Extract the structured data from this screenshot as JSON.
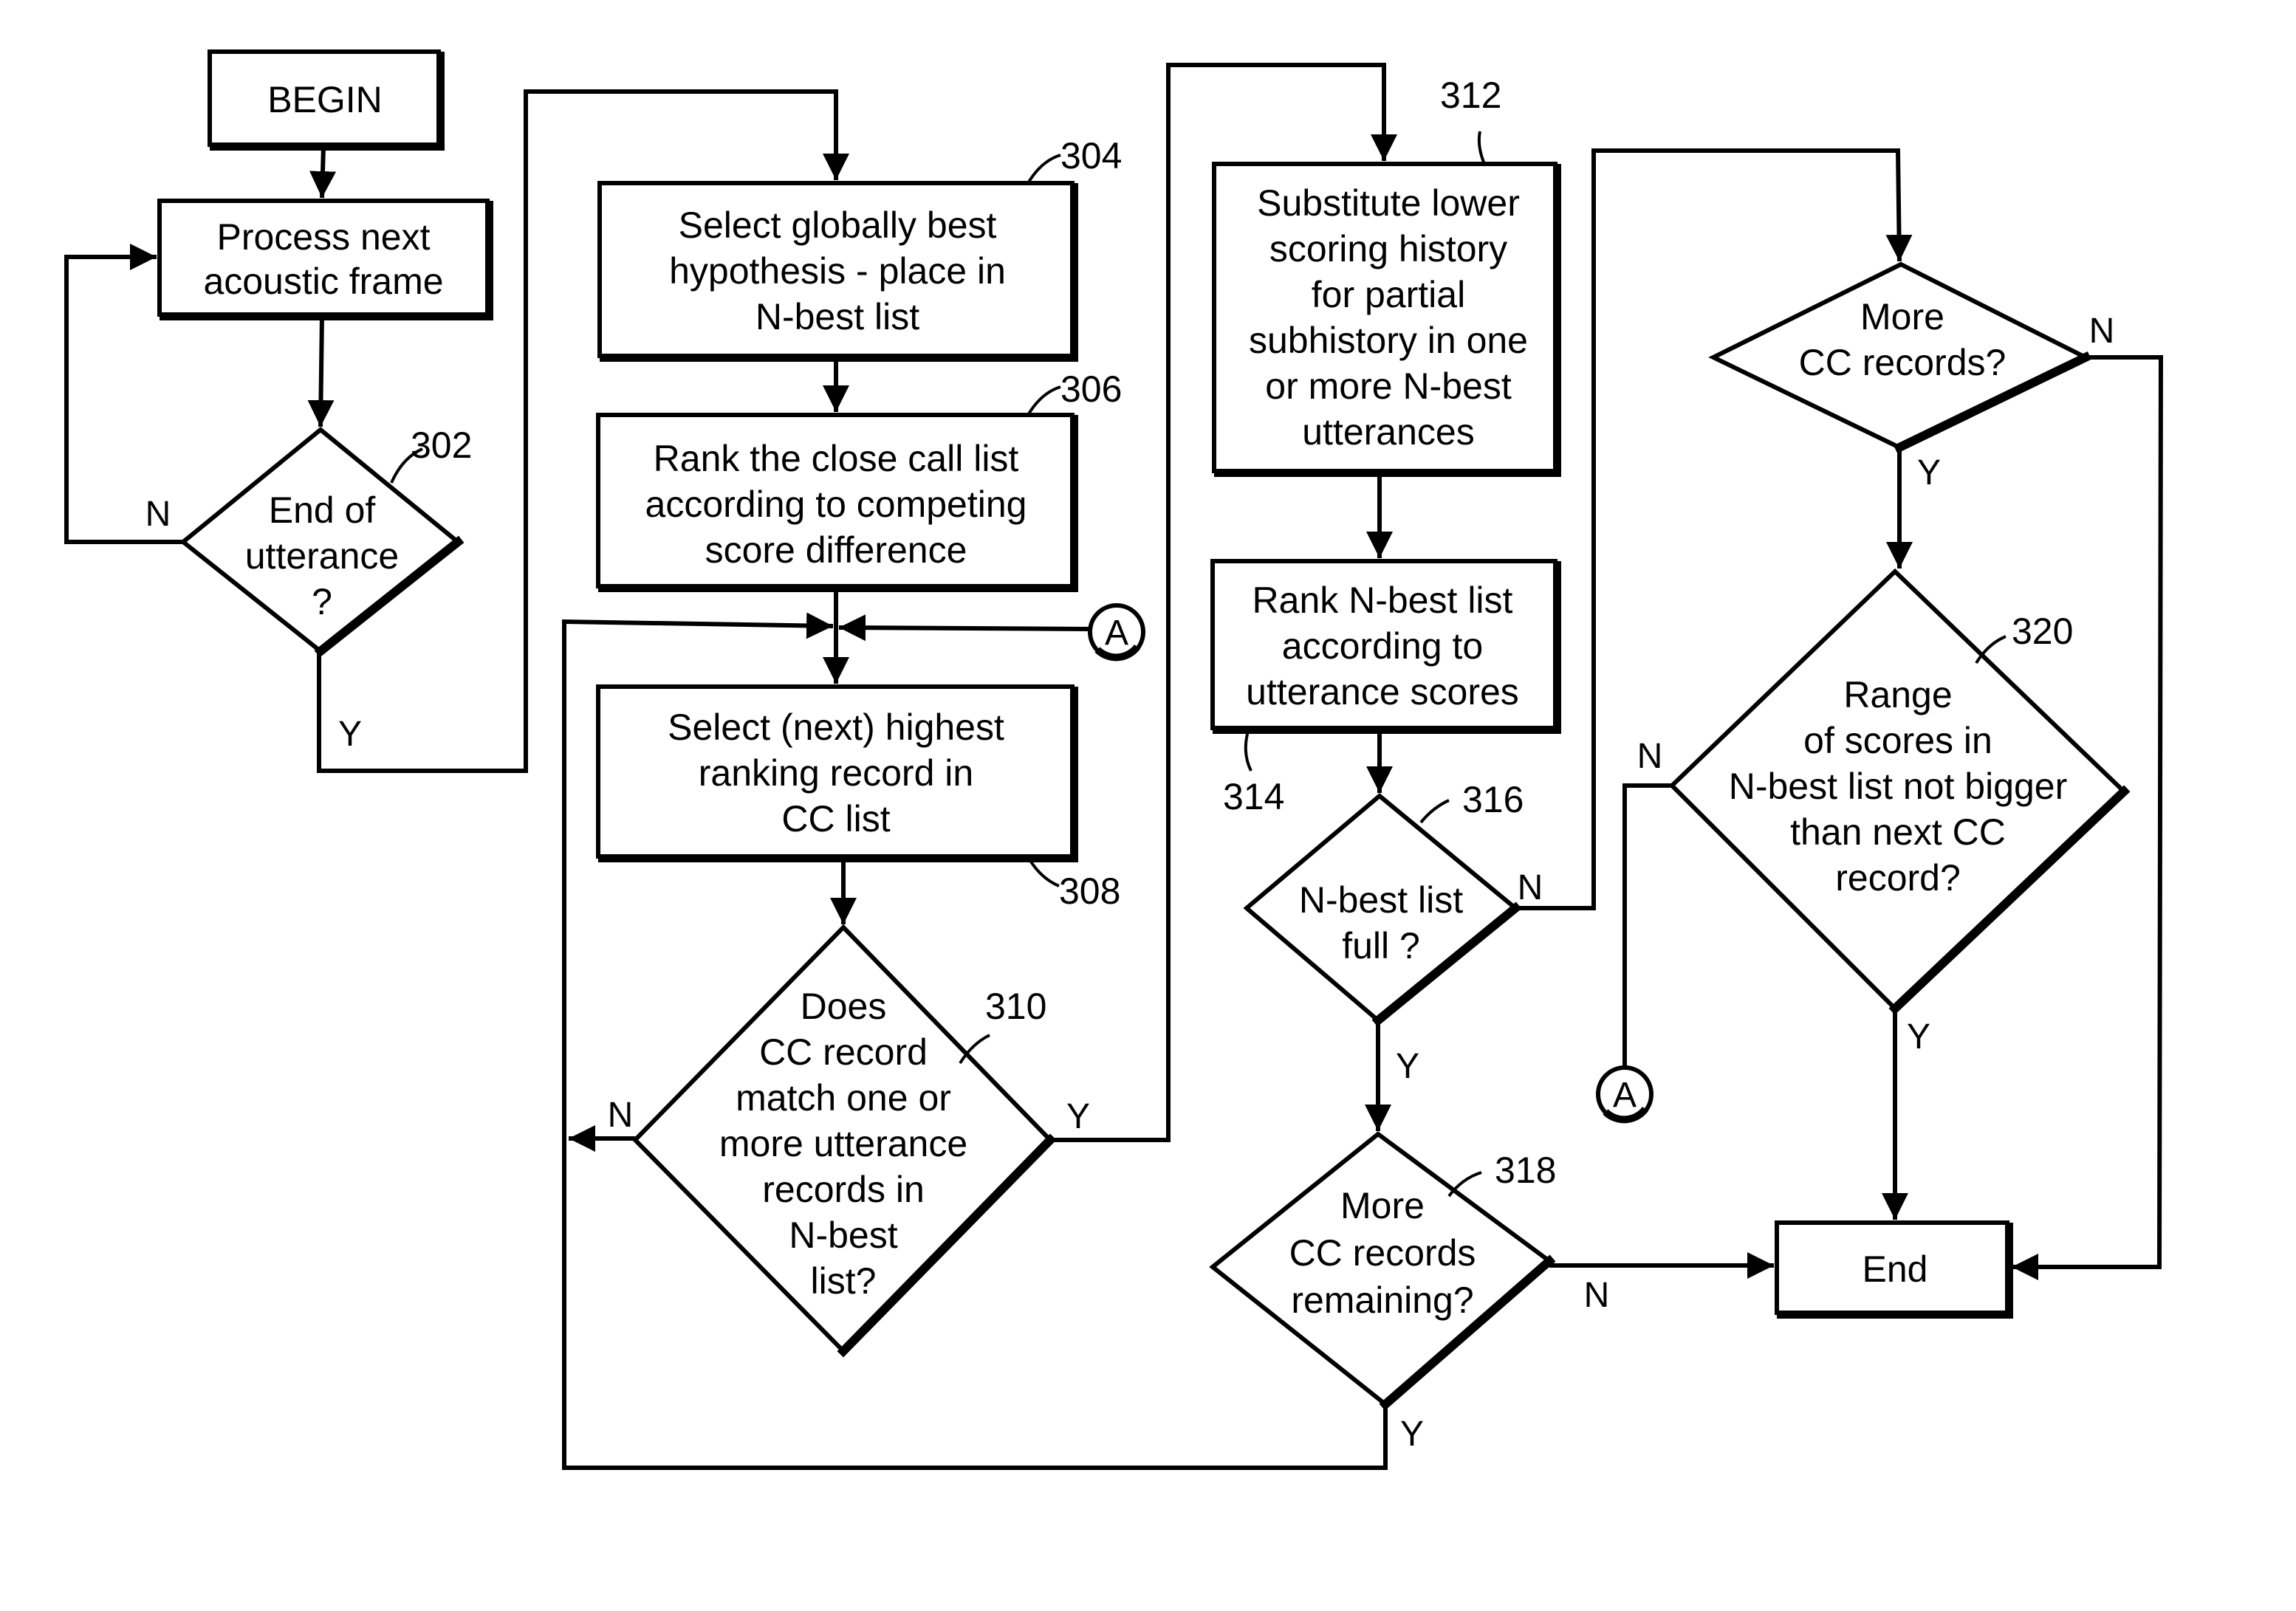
{
  "diagram": {
    "type": "flowchart",
    "nodes": {
      "begin": {
        "id": "begin",
        "kind": "terminal",
        "lines": [
          "BEGIN"
        ]
      },
      "process_frame": {
        "id": "process_frame",
        "kind": "process",
        "lines": [
          "Process next",
          "acoustic frame"
        ]
      },
      "n302": {
        "id": "302",
        "kind": "decision",
        "ref": "302",
        "lines": [
          "End of",
          "utterance",
          "?"
        ]
      },
      "n304": {
        "id": "304",
        "kind": "process",
        "ref": "304",
        "lines": [
          "Select globally best",
          "hypothesis - place in",
          "N-best list"
        ]
      },
      "n306": {
        "id": "306",
        "kind": "process",
        "ref": "306",
        "lines": [
          "Rank the close call list",
          "according to competing",
          "score difference"
        ]
      },
      "n308": {
        "id": "308",
        "kind": "process",
        "ref": "308",
        "lines": [
          "Select (next) highest",
          "ranking record in",
          "CC list"
        ]
      },
      "n310": {
        "id": "310",
        "kind": "decision",
        "ref": "310",
        "lines": [
          "Does",
          "CC record",
          "match one or",
          "more utterance",
          "records in",
          "N-best",
          "list?"
        ]
      },
      "n312": {
        "id": "312",
        "kind": "process",
        "ref": "312",
        "lines": [
          "Substitute lower",
          "scoring history",
          "for partial",
          "subhistory in one",
          "or more N-best",
          "utterances"
        ]
      },
      "n314": {
        "id": "314",
        "kind": "process",
        "ref": "314",
        "lines": [
          "Rank N-best list",
          "according to",
          "utterance scores"
        ]
      },
      "n316": {
        "id": "316",
        "kind": "decision",
        "ref": "316",
        "lines": [
          "N-best list",
          "full ?"
        ]
      },
      "n318": {
        "id": "318",
        "kind": "decision",
        "ref": "318",
        "lines": [
          "More",
          "CC records",
          "remaining?"
        ]
      },
      "more_cc": {
        "id": "more_cc",
        "kind": "decision",
        "lines": [
          "More",
          "CC records?"
        ]
      },
      "n320": {
        "id": "320",
        "kind": "decision",
        "ref": "320",
        "lines": [
          "Range",
          "of scores in",
          "N-best list not bigger",
          "than next CC",
          "record?"
        ]
      },
      "end": {
        "id": "end",
        "kind": "terminal",
        "lines": [
          "End"
        ]
      }
    },
    "connectors": {
      "a_top": {
        "label": "A"
      },
      "a_bottom": {
        "label": "A"
      }
    },
    "edges": [
      {
        "from": "begin",
        "to": "process_frame",
        "label": ""
      },
      {
        "from": "process_frame",
        "to": "302",
        "label": ""
      },
      {
        "from": "302",
        "to": "process_frame",
        "label": "N"
      },
      {
        "from": "302",
        "to": "304",
        "label": "Y"
      },
      {
        "from": "304",
        "to": "306",
        "label": ""
      },
      {
        "from": "306",
        "to": "308",
        "label": ""
      },
      {
        "from": "A",
        "to": "308",
        "label": ""
      },
      {
        "from": "308",
        "to": "310",
        "label": ""
      },
      {
        "from": "310",
        "to": "308",
        "label": "N"
      },
      {
        "from": "310",
        "to": "312",
        "label": "Y"
      },
      {
        "from": "312",
        "to": "314",
        "label": ""
      },
      {
        "from": "314",
        "to": "316",
        "label": ""
      },
      {
        "from": "316",
        "to": "more_cc",
        "label": "N"
      },
      {
        "from": "316",
        "to": "318",
        "label": "Y"
      },
      {
        "from": "318",
        "to": "308",
        "label": "Y"
      },
      {
        "from": "318",
        "to": "end",
        "label": "N"
      },
      {
        "from": "more_cc",
        "to": "320",
        "label": "Y"
      },
      {
        "from": "more_cc",
        "to": "end",
        "label": "N"
      },
      {
        "from": "320",
        "to": "end",
        "label": "Y"
      },
      {
        "from": "320",
        "to": "A",
        "label": "N"
      }
    ],
    "edge_labels": {
      "yes": "Y",
      "no": "N"
    }
  }
}
